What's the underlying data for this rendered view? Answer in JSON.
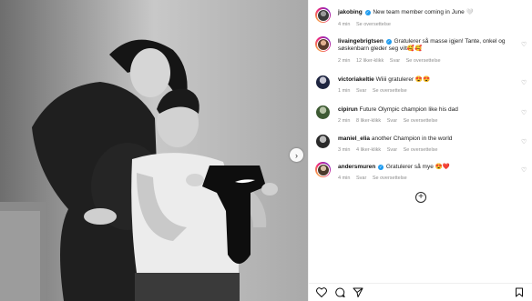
{
  "post": {
    "next_icon": "chevron-right-icon"
  },
  "caption": {
    "username": "jakobing",
    "text": "New team member coming in June 🤍",
    "time": "4 min",
    "translate": "Se oversettelse"
  },
  "comments": [
    {
      "username": "livaingebrigtsen",
      "verified": true,
      "text": "Gratulerer så masse igjen! Tante, onkel og søskenbarn gleder seg vilt🥰🥰",
      "time": "2 min",
      "likes": "12 liker-klikk",
      "reply": "Svar",
      "translate": "Se oversettelse"
    },
    {
      "username": "victoriakeltie",
      "verified": false,
      "text": "Wiiii gratulerer 😍😍",
      "time": "1 min",
      "reply": "Svar",
      "translate": "Se oversettelse"
    },
    {
      "username": "cipirun",
      "verified": false,
      "text": "Future Olympic champion like his dad",
      "time": "2 min",
      "likes": "8 liker-klikk",
      "reply": "Svar",
      "translate": "Se oversettelse"
    },
    {
      "username": "maniel_elia",
      "verified": false,
      "text": "another Champion in the world",
      "time": "3 min",
      "likes": "4 liker-klikk",
      "reply": "Svar",
      "translate": "Se oversettelse"
    },
    {
      "username": "andersmuren",
      "verified": true,
      "text": "Gratulerer så mye 😍❤️",
      "time": "4 min",
      "reply": "Svar",
      "translate": "Se oversettelse"
    }
  ],
  "icons": {
    "like": "heart-icon",
    "comment": "comment-icon",
    "share": "share-icon",
    "save": "bookmark-icon",
    "load_more": "plus-circle-icon",
    "verified": "verified-badge-icon"
  },
  "symbols": {
    "verified_mark": "✓",
    "load_more": "+",
    "next": "›"
  }
}
